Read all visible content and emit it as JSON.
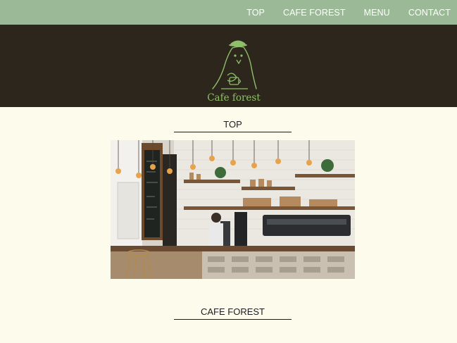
{
  "nav": {
    "items": [
      "TOP",
      "CAFE FOREST",
      "MENU",
      "CONTACT"
    ]
  },
  "header": {
    "logo_text": "Cafe forest",
    "logo_icon": "bird-with-hat-icon"
  },
  "sections": [
    {
      "title": "TOP"
    },
    {
      "title": "CAFE FOREST"
    }
  ],
  "hero_image": {
    "subject": "cafe interior photo"
  },
  "colors": {
    "nav_bg": "#9bb996",
    "header_bg": "#2d261c",
    "page_bg": "#fdfbec",
    "logo_green": "#8fbf6a"
  }
}
